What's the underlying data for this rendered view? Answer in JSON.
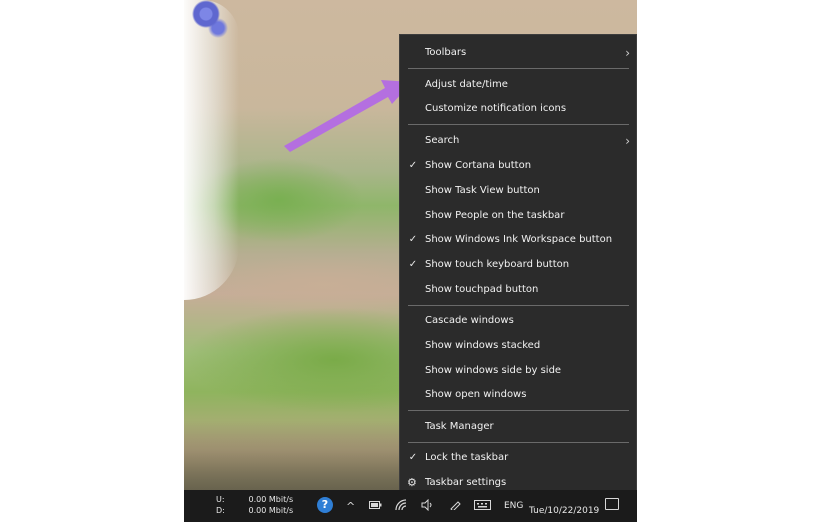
{
  "context_menu": {
    "items": [
      {
        "label": "Toolbars",
        "submenu": true
      },
      {
        "label": "Adjust date/time"
      },
      {
        "label": "Customize notification icons"
      },
      {
        "label": "Search",
        "submenu": true
      },
      {
        "label": "Show Cortana button",
        "checked": true
      },
      {
        "label": "Show Task View button"
      },
      {
        "label": "Show People on the taskbar"
      },
      {
        "label": "Show Windows Ink Workspace button",
        "checked": true
      },
      {
        "label": "Show touch keyboard button",
        "checked": true
      },
      {
        "label": "Show touchpad button"
      },
      {
        "label": "Cascade windows"
      },
      {
        "label": "Show windows stacked"
      },
      {
        "label": "Show windows side by side"
      },
      {
        "label": "Show open windows"
      },
      {
        "label": "Task Manager"
      },
      {
        "label": "Lock the taskbar",
        "checked": true
      },
      {
        "label": "Taskbar settings",
        "icon": "gear-icon"
      }
    ],
    "check_glyph": "✓",
    "chevron_glyph": "›",
    "gear_glyph": "⚙"
  },
  "taskbar": {
    "net_upload_label": "U:",
    "net_upload_value": "0.00 Mbit/s",
    "net_download_label": "D:",
    "net_download_value": "0.00 Mbit/s",
    "help_glyph": "?",
    "tray_chevron_glyph": "^",
    "language": "ENG",
    "date": "Tue/10/22/2019"
  },
  "colors": {
    "menu_bg": "#2b2b2b",
    "taskbar_bg": "#1b1b1b",
    "arrow": "#b46fe0"
  }
}
